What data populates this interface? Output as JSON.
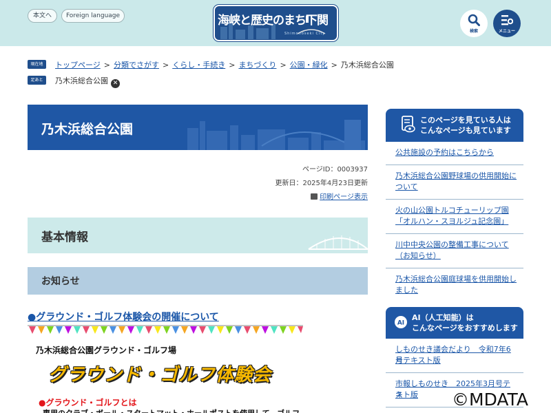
{
  "header": {
    "main_text_link": "本文へ",
    "language_link": "Foreign language",
    "logo": {
      "text": "海峡と歴史のまち下関",
      "subtitle": "Shimonoseki City"
    },
    "search_label": "検索",
    "menu_label": "メニュー",
    "brand_color": "#1f4e8c",
    "header_bg": "#cbe9ea"
  },
  "breadcrumb": {
    "current_tag": "現在地",
    "items": [
      "トップページ",
      "分類でさがす",
      "くらし・手続き",
      "まちづくり",
      "公園・緑化"
    ],
    "current": "乃木浜総合公園"
  },
  "footprint": {
    "tag": "足あと",
    "item": "乃木浜総合公園"
  },
  "page": {
    "title": "乃木浜総合公園",
    "page_id": "ページID：0003937",
    "updated": "更新日：2025年4月23日更新",
    "print_link": "印刷ページ表示"
  },
  "content": {
    "section_heading": "基本情報",
    "sub_heading": "お知らせ",
    "article_link": "●グラウンド・ゴルフ体験会の開催について",
    "poster": {
      "line1": "乃木浜総合公園グラウンド・ゴルフ場",
      "title": "グラウンド・ゴルフ体験会",
      "sub": "●グラウンド・ゴルフとは",
      "body": "専用のクラブ・ボール・スタートマット・ホールポストを使用して、ゴルフ"
    }
  },
  "sidebar": {
    "related_heading_line1": "このページを見ている人は",
    "related_heading_line2": "こんなページも見ています",
    "related_items": [
      [
        "公共施設の予約はこちらから"
      ],
      [
        "乃木浜総合公園野球場の供用開始に",
        "ついて"
      ],
      [
        "火の山公園トルコチューリップ園",
        "「オルハン・スヨルジュ記念園」"
      ],
      [
        "川中中央公園の整備工事について",
        "（お知らせ）"
      ],
      [
        "乃木浜総合公園庭球場を供用開始し",
        "ました"
      ]
    ],
    "ai_heading_line1": "AI（人工知能）は",
    "ai_heading_line2": "こんなページをおすすめします",
    "ai_items": [
      [
        "しものせき議会だより　令和7年6月",
        "号テキスト版"
      ],
      [
        "市報しものせき　2025年3月号テキ",
        "スト版"
      ]
    ]
  },
  "watermark": "©MDATA"
}
